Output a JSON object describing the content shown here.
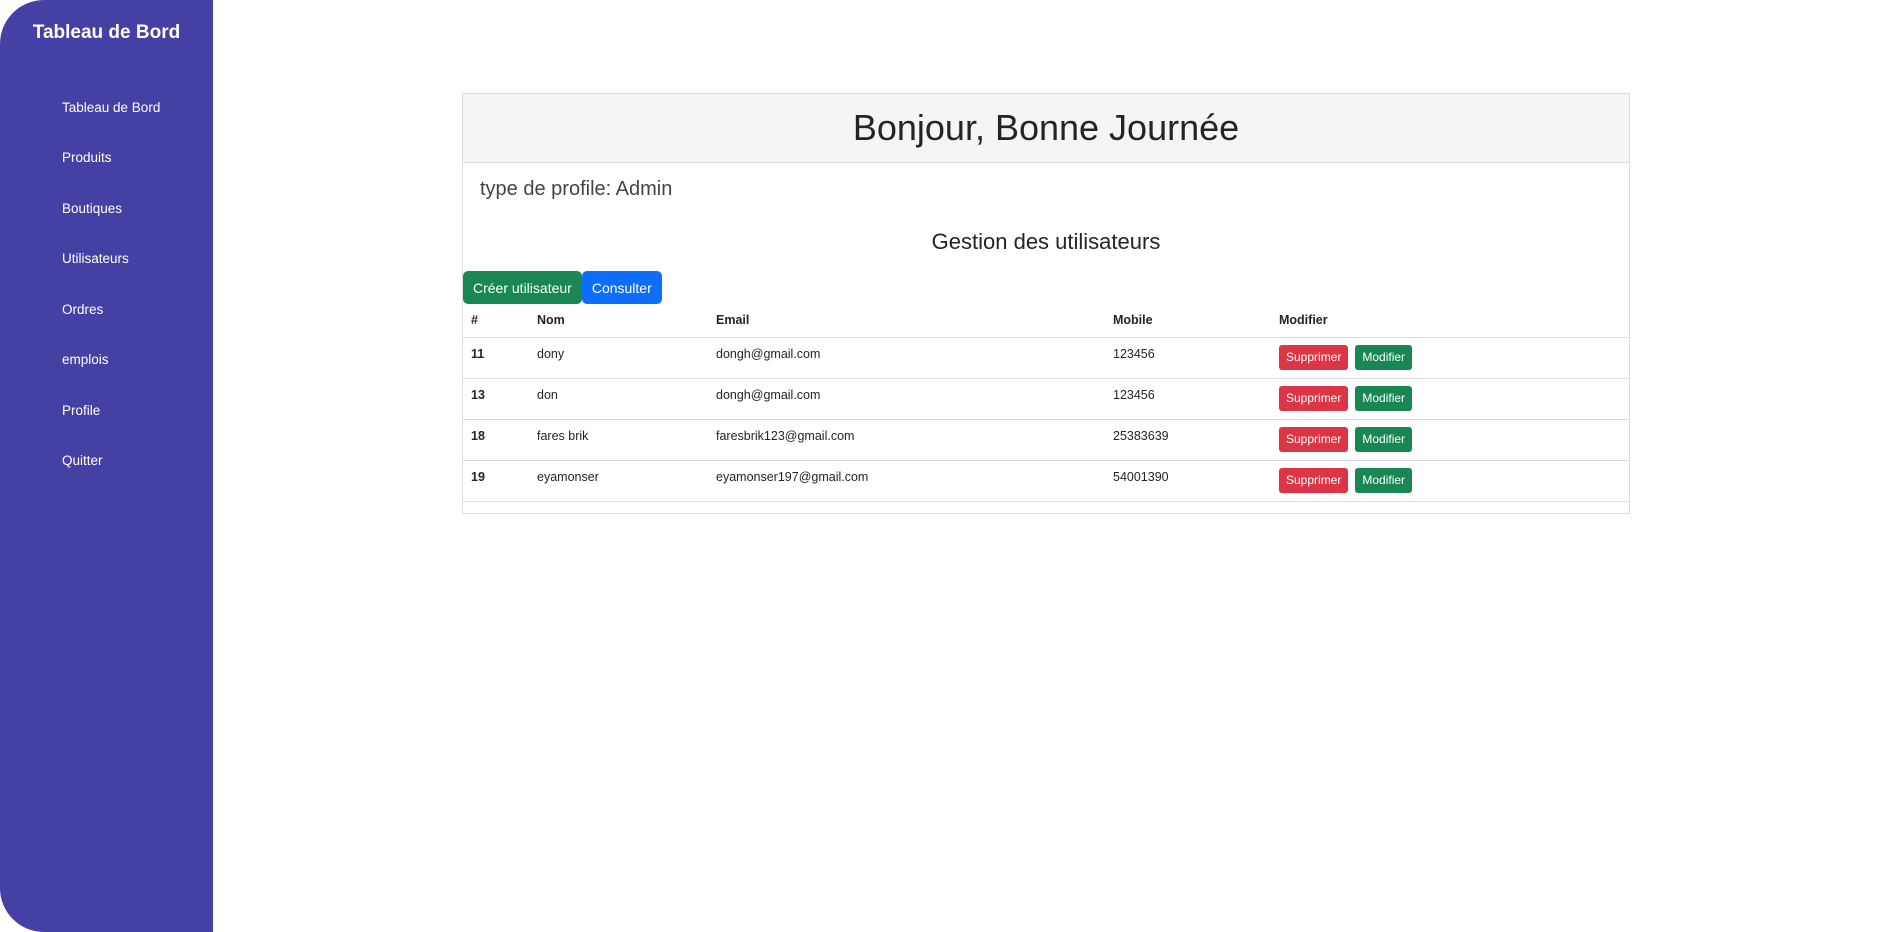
{
  "sidebar": {
    "title": "Tableau de Bord",
    "items": [
      "Tableau de Bord",
      "Produits",
      "Boutiques",
      "Utilisateurs",
      "Ordres",
      "emplois",
      "Profile",
      "Quitter"
    ]
  },
  "card": {
    "header": "Bonjour, Bonne Journée",
    "profile": "type de profile: Admin",
    "section_title": "Gestion des utilisateurs",
    "create_label": "Créer utilisateur",
    "consult_label": "Consulter"
  },
  "table": {
    "headers": [
      "#",
      "Nom",
      "Email",
      "Mobile",
      "Modifier"
    ],
    "delete_label": "Supprimer",
    "edit_label": "Modifier",
    "rows": [
      {
        "id": "11",
        "nom": "dony",
        "email": "dongh@gmail.com",
        "mobile": "123456"
      },
      {
        "id": "13",
        "nom": "don",
        "email": "dongh@gmail.com",
        "mobile": "123456"
      },
      {
        "id": "18",
        "nom": "fares brik",
        "email": "faresbrik123@gmail.com",
        "mobile": "25383639"
      },
      {
        "id": "19",
        "nom": "eyamonser",
        "email": "eyamonser197@gmail.com",
        "mobile": "54001390"
      }
    ]
  },
  "colors": {
    "sidebar": "#4540a3",
    "green": "#198754",
    "blue": "#0d6efd",
    "red": "#dc3545"
  }
}
